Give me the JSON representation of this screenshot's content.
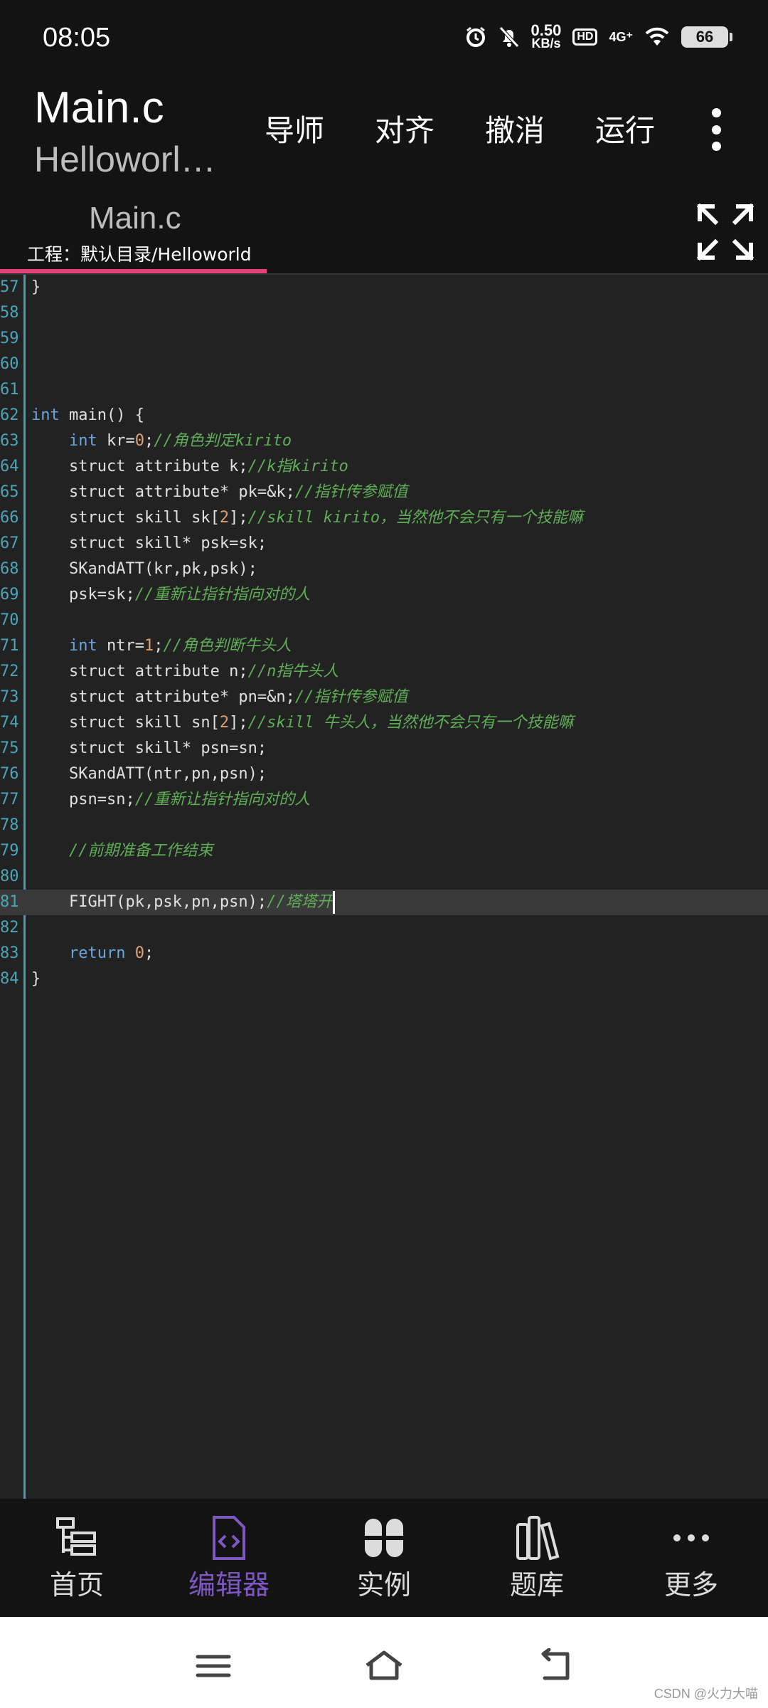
{
  "status_bar": {
    "time": "08:05",
    "speed_value": "0.50",
    "speed_unit": "KB/s",
    "hd": "HD",
    "network": "4G⁺",
    "battery": "66"
  },
  "app_bar": {
    "title": "Main.c",
    "subtitle": "Helloworl…",
    "actions": [
      "导师",
      "对齐",
      "撤消",
      "运行"
    ]
  },
  "tab": {
    "file_name": "Main.c",
    "project": "工程：默认目录/Helloworld"
  },
  "code": [
    {
      "n": "57",
      "text": "}"
    },
    {
      "n": "58",
      "text": ""
    },
    {
      "n": "59",
      "text": ""
    },
    {
      "n": "60",
      "text": ""
    },
    {
      "n": "61",
      "text": ""
    },
    {
      "n": "62",
      "text": "int main() {"
    },
    {
      "n": "63",
      "text": "    int kr=0;//角色判定kirito"
    },
    {
      "n": "64",
      "text": "    struct attribute k;//k指kirito"
    },
    {
      "n": "65",
      "text": "    struct attribute* pk=&k;//指针传参赋值"
    },
    {
      "n": "66",
      "text": "    struct skill sk[2];//skill kirito，当然他不会只有一个技能嘛"
    },
    {
      "n": "67",
      "text": "    struct skill* psk=sk;"
    },
    {
      "n": "68",
      "text": "    SKandATT(kr,pk,psk);"
    },
    {
      "n": "69",
      "text": "    psk=sk;//重新让指针指向对的人"
    },
    {
      "n": "70",
      "text": ""
    },
    {
      "n": "71",
      "text": "    int ntr=1;//角色判断牛头人"
    },
    {
      "n": "72",
      "text": "    struct attribute n;//n指牛头人"
    },
    {
      "n": "73",
      "text": "    struct attribute* pn=&n;//指针传参赋值"
    },
    {
      "n": "74",
      "text": "    struct skill sn[2];//skill 牛头人，当然他不会只有一个技能嘛"
    },
    {
      "n": "75",
      "text": "    struct skill* psn=sn;"
    },
    {
      "n": "76",
      "text": "    SKandATT(ntr,pn,psn);"
    },
    {
      "n": "77",
      "text": "    psn=sn;//重新让指针指向对的人"
    },
    {
      "n": "78",
      "text": ""
    },
    {
      "n": "79",
      "text": "    //前期准备工作结束"
    },
    {
      "n": "80",
      "text": ""
    },
    {
      "n": "81",
      "text": "    FIGHT(pk,psk,pn,psn);//塔塔开"
    },
    {
      "n": "82",
      "text": ""
    },
    {
      "n": "83",
      "text": "    return 0;"
    },
    {
      "n": "84",
      "text": "}"
    }
  ],
  "bottom_nav": [
    {
      "label": "首页",
      "icon": "home-tree-icon"
    },
    {
      "label": "编辑器",
      "icon": "code-file-icon"
    },
    {
      "label": "实例",
      "icon": "examples-icon"
    },
    {
      "label": "题库",
      "icon": "books-icon"
    },
    {
      "label": "更多",
      "icon": "more-dots-icon"
    }
  ],
  "watermark": "CSDN @火力大喵",
  "colors": {
    "accent_purple": "#7e57c2",
    "tab_indicator": "#e6407a",
    "keyword": "#6aa6e0",
    "comment": "#5fae57",
    "number": "#e0a070",
    "line_number": "#4ba6bc"
  }
}
